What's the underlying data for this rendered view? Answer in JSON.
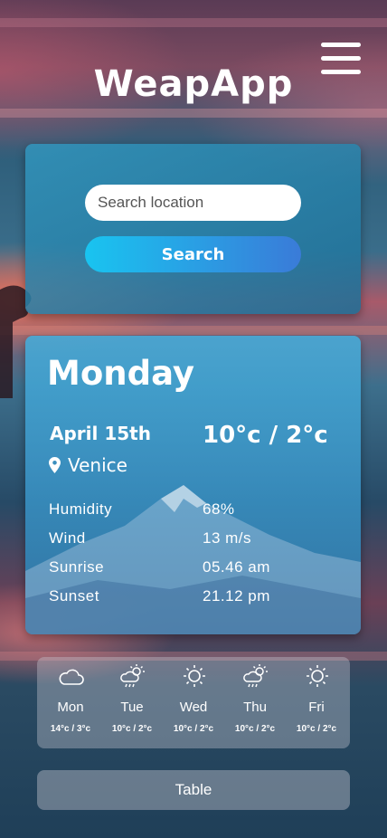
{
  "app": {
    "title": "WeapApp"
  },
  "search": {
    "placeholder": "Search location",
    "button_label": "Search"
  },
  "current": {
    "day": "Monday",
    "date": "April 15th",
    "temp": "10°c / 2°c",
    "location": "Venice",
    "details": [
      {
        "label": "Humidity",
        "value": "68%"
      },
      {
        "label": "Wind",
        "value": "13 m/s"
      },
      {
        "label": "Sunrise",
        "value": "05.46 am"
      },
      {
        "label": "Sunset",
        "value": "21.12 pm"
      }
    ]
  },
  "forecast": [
    {
      "day": "Mon",
      "temp": "14°c / 3°c",
      "icon": "cloud-icon"
    },
    {
      "day": "Tue",
      "temp": "10°c / 2°c",
      "icon": "sun-cloud-rain-icon"
    },
    {
      "day": "Wed",
      "temp": "10°c / 2°c",
      "icon": "sun-icon"
    },
    {
      "day": "Thu",
      "temp": "10°c / 2°c",
      "icon": "sun-cloud-rain-icon"
    },
    {
      "day": "Fri",
      "temp": "10°c / 2°c",
      "icon": "sun-icon"
    }
  ],
  "table_button": {
    "label": "Table"
  }
}
